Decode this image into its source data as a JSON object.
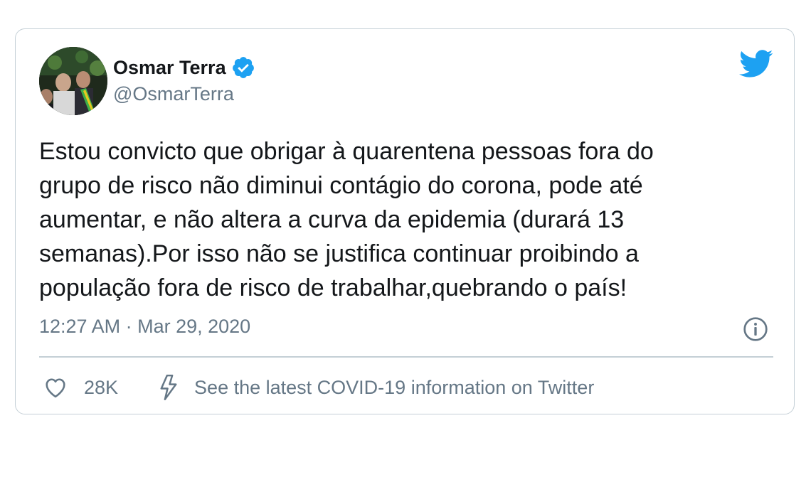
{
  "author": {
    "name": "Osmar Terra",
    "handle": "@OsmarTerra",
    "verified": true
  },
  "tweet": {
    "lines": [
      "Estou convicto que obrigar à quarentena pessoas fora do",
      "grupo de risco não diminui contágio do corona, pode até",
      "aumentar, e não altera a curva da epidemia (durará 13",
      "semanas).Por isso não se justifica continuar proibindo a",
      "população fora de risco de trabalhar,quebrando o país!"
    ],
    "timestamp": "12:27 AM · Mar 29, 2020"
  },
  "actions": {
    "like_count": "28K",
    "covid_info_link": "See the latest COVID-19 information on Twitter"
  },
  "icons": {
    "brand": "twitter-bird-icon",
    "verified": "verified-badge-icon",
    "info": "info-icon",
    "like": "heart-icon",
    "covid": "lightning-bolt-icon"
  },
  "colors": {
    "brand_blue": "#1da1f2",
    "text_primary": "#14171a",
    "text_secondary": "#657786",
    "border": "#c4cfd6"
  }
}
